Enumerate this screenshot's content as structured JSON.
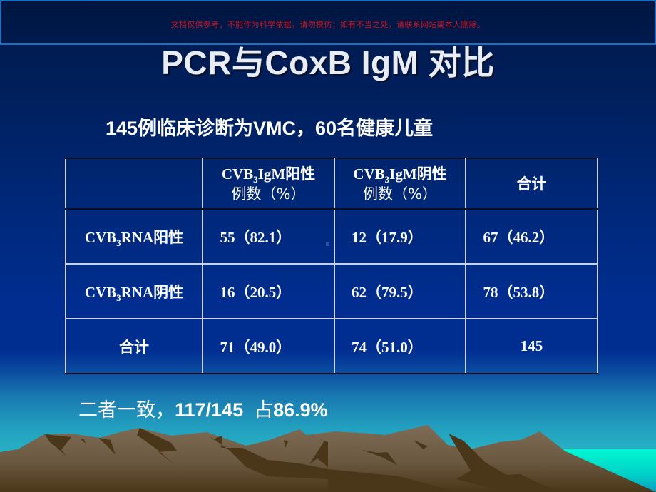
{
  "banner": {
    "notice": "文档仅供参考，不能作为科学依据，请勿模仿；如有不当之处，请联系网站或本人删除。"
  },
  "slide": {
    "title": "PCR与CoxB IgM 对比",
    "subtitle": "145例临床诊断为VMC，60名健康儿童"
  },
  "table": {
    "header": {
      "col1_line1_prefix": "CVB",
      "col1_line1_sub": "3",
      "col1_line1_suffix": "IgM阳性",
      "col1_line2": "例数（%）",
      "col2_line1_prefix": "CVB",
      "col2_line1_sub": "3",
      "col2_line1_suffix": "IgM阴性",
      "col2_line2": "例数（%）",
      "col3": "合计"
    },
    "rows": [
      {
        "label_prefix": "CVB",
        "label_sub": "3",
        "label_suffix": "RNA阳性",
        "c1": "55（82.1）",
        "c2": "12（17.9）",
        "c3": "67（46.2）"
      },
      {
        "label_prefix": "CVB",
        "label_sub": "3",
        "label_suffix": "RNA阴性",
        "c1": "16（20.5）",
        "c2": "62（79.5）",
        "c3": "78（53.8）"
      },
      {
        "label": "合计",
        "c1": "71（49.0）",
        "c2": "74（51.0）",
        "c3": "145"
      }
    ]
  },
  "footer": {
    "lead": "二者一致，",
    "ratio": "117/145",
    "mid": "占",
    "percent": "86.9%"
  },
  "colors": {
    "banner_text": "#d0121b",
    "banner_border": "#1f6fc0",
    "background_top": "#001848",
    "background_mid": "#002d8f",
    "background_bottom": "#28b4c6",
    "sea": "#00f5d0",
    "mountain_light": "#7a6a52",
    "mountain_shadow": "#4a3618"
  }
}
